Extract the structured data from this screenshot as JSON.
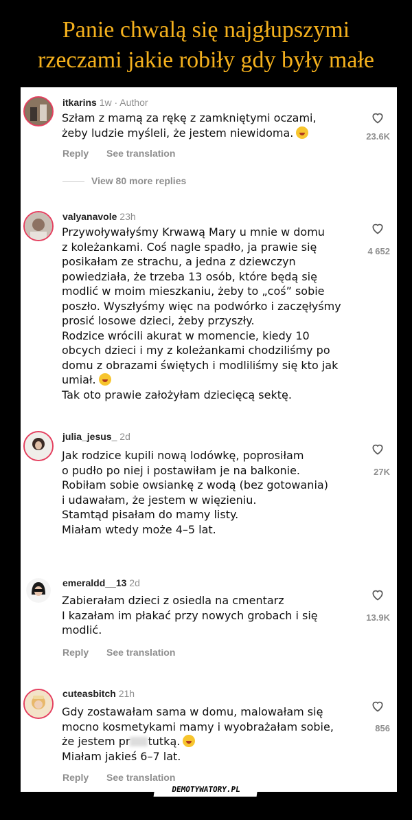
{
  "title": {
    "line1": "Panie chwalą się najgłupszymi",
    "line2": "rzeczami jakie robiły gdy były małe"
  },
  "comments": [
    {
      "user": "itkarins",
      "meta": "1w · Author",
      "lines": [
        "Szłam z mamą za rękę z zamkniętymi oczami,",
        "żeby ludzie myśleli, że jestem niewidoma."
      ],
      "likes": "23.6K",
      "reply": "Reply",
      "translate": "See translation",
      "more": "View 80 more replies"
    },
    {
      "user": "valyanavole",
      "meta": "23h",
      "lines": [
        "Przywoływałyśmy Krwawą Mary u mnie w domu",
        "z koleżankami. Coś nagle spadło, ja prawie się",
        "posikałam ze strachu, a jedna z dziewczyn",
        "powiedziała, że trzeba 13 osób, które będą się",
        "modlić w moim mieszkaniu, żeby to „coś” sobie",
        "poszło. Wyszłyśmy więc na podwórko i zaczęłyśmy",
        "prosić losowe dzieci, żeby przyszły.",
        "Rodzice wrócili akurat w momencie, kiedy 10",
        "obcych dzieci i my z koleżankami chodziliśmy po",
        "domu z obrazami świętych i modliliśmy się kto jak",
        "umiał.",
        "Tak oto prawie założyłam dziecięcą sektę."
      ],
      "likes": "4 652"
    },
    {
      "user": "julia_jesus_",
      "meta": "2d",
      "lines": [
        "Jak rodzice kupili nową lodówkę, poprosiłam",
        "o pudło po niej i postawiłam je na balkonie.",
        "Robiłam sobie owsiankę z wodą (bez gotowania)",
        "i udawałam, że jestem w więzieniu.",
        "Stamtąd pisałam do mamy listy.",
        "Miałam wtedy może 4–5 lat."
      ],
      "likes": "27K"
    },
    {
      "user": "emeraldd__13",
      "meta": "2d",
      "lines": [
        "Zabierałam dzieci z osiedla na cmentarz",
        "I kazałam im płakać przy nowych grobach i się",
        "modlić."
      ],
      "likes": "13.9K",
      "reply": "Reply",
      "translate": "See translation"
    },
    {
      "user": "cuteasbitch",
      "meta": "21h",
      "lines": [
        "Gdy zostawałam sama w domu, malowałam się",
        "mocno kosmetykami mamy i wyobrażałam sobie,",
        "że jestem pr",
        "tutką.",
        "Miałam jakieś 6–7 lat."
      ],
      "likes": "856",
      "reply": "Reply",
      "translate": "See translation"
    }
  ],
  "watermark": "DEMOTYWATORY.PL"
}
